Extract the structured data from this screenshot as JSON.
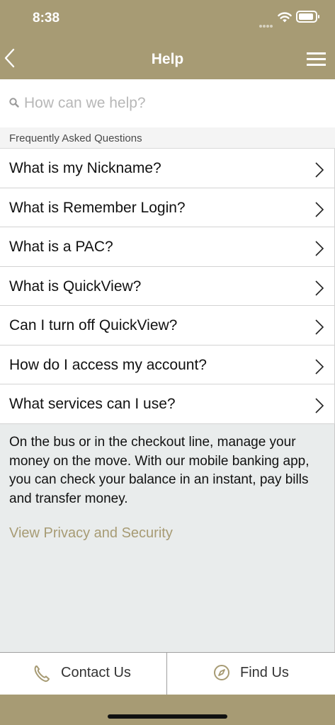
{
  "status": {
    "time": "8:38"
  },
  "nav": {
    "title": "Help"
  },
  "search": {
    "placeholder": "How can we help?"
  },
  "faq": {
    "section_title": "Frequently Asked Questions",
    "items": [
      {
        "label": "What is my Nickname?"
      },
      {
        "label": "What is Remember Login?"
      },
      {
        "label": "What is a PAC?"
      },
      {
        "label": "What is QuickView?"
      },
      {
        "label": "Can I turn off QuickView?"
      },
      {
        "label": "How do I access my account?"
      },
      {
        "label": "What services can I use?"
      }
    ]
  },
  "info": {
    "body": "On the bus or in the checkout line, manage your money on the move. With our mobile banking app, you can check your balance in an instant, pay bills and transfer money.",
    "privacy_link": "View Privacy and Security"
  },
  "bottom": {
    "contact_label": "Contact Us",
    "find_label": "Find Us"
  },
  "colors": {
    "brand": "#a79b74",
    "background": "#e9ecec",
    "link": "#a79b74"
  },
  "icons": [
    "chevron-left-icon",
    "hamburger-menu-icon",
    "search-icon",
    "chevron-right-icon",
    "phone-icon",
    "compass-icon",
    "wifi-icon",
    "battery-icon",
    "signal-icon"
  ]
}
